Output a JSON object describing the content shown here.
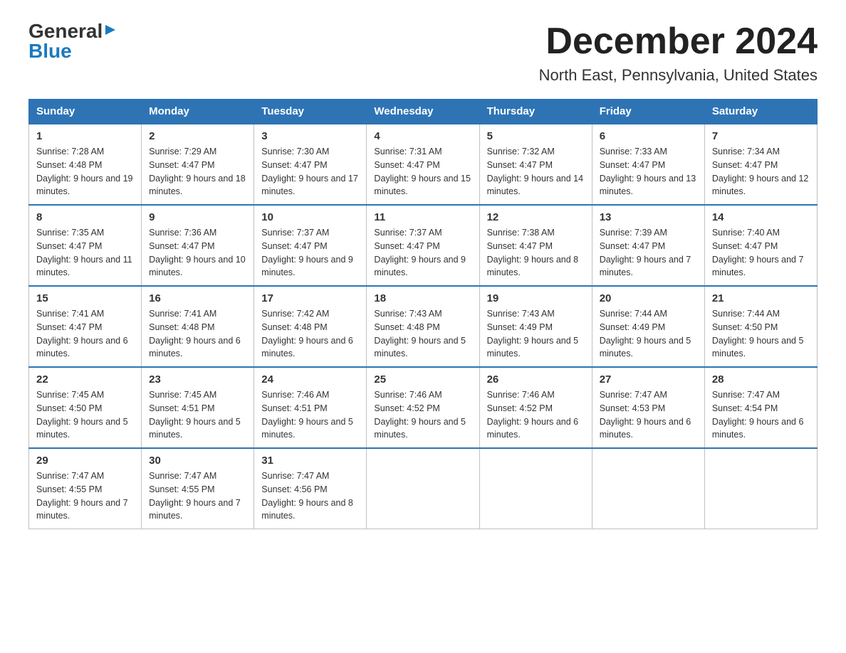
{
  "header": {
    "logo_general": "General",
    "logo_blue": "Blue",
    "month_title": "December 2024",
    "location": "North East, Pennsylvania, United States"
  },
  "days_of_week": [
    "Sunday",
    "Monday",
    "Tuesday",
    "Wednesday",
    "Thursday",
    "Friday",
    "Saturday"
  ],
  "weeks": [
    [
      {
        "day": "1",
        "sunrise": "7:28 AM",
        "sunset": "4:48 PM",
        "daylight": "9 hours and 19 minutes."
      },
      {
        "day": "2",
        "sunrise": "7:29 AM",
        "sunset": "4:47 PM",
        "daylight": "9 hours and 18 minutes."
      },
      {
        "day": "3",
        "sunrise": "7:30 AM",
        "sunset": "4:47 PM",
        "daylight": "9 hours and 17 minutes."
      },
      {
        "day": "4",
        "sunrise": "7:31 AM",
        "sunset": "4:47 PM",
        "daylight": "9 hours and 15 minutes."
      },
      {
        "day": "5",
        "sunrise": "7:32 AM",
        "sunset": "4:47 PM",
        "daylight": "9 hours and 14 minutes."
      },
      {
        "day": "6",
        "sunrise": "7:33 AM",
        "sunset": "4:47 PM",
        "daylight": "9 hours and 13 minutes."
      },
      {
        "day": "7",
        "sunrise": "7:34 AM",
        "sunset": "4:47 PM",
        "daylight": "9 hours and 12 minutes."
      }
    ],
    [
      {
        "day": "8",
        "sunrise": "7:35 AM",
        "sunset": "4:47 PM",
        "daylight": "9 hours and 11 minutes."
      },
      {
        "day": "9",
        "sunrise": "7:36 AM",
        "sunset": "4:47 PM",
        "daylight": "9 hours and 10 minutes."
      },
      {
        "day": "10",
        "sunrise": "7:37 AM",
        "sunset": "4:47 PM",
        "daylight": "9 hours and 9 minutes."
      },
      {
        "day": "11",
        "sunrise": "7:37 AM",
        "sunset": "4:47 PM",
        "daylight": "9 hours and 9 minutes."
      },
      {
        "day": "12",
        "sunrise": "7:38 AM",
        "sunset": "4:47 PM",
        "daylight": "9 hours and 8 minutes."
      },
      {
        "day": "13",
        "sunrise": "7:39 AM",
        "sunset": "4:47 PM",
        "daylight": "9 hours and 7 minutes."
      },
      {
        "day": "14",
        "sunrise": "7:40 AM",
        "sunset": "4:47 PM",
        "daylight": "9 hours and 7 minutes."
      }
    ],
    [
      {
        "day": "15",
        "sunrise": "7:41 AM",
        "sunset": "4:47 PM",
        "daylight": "9 hours and 6 minutes."
      },
      {
        "day": "16",
        "sunrise": "7:41 AM",
        "sunset": "4:48 PM",
        "daylight": "9 hours and 6 minutes."
      },
      {
        "day": "17",
        "sunrise": "7:42 AM",
        "sunset": "4:48 PM",
        "daylight": "9 hours and 6 minutes."
      },
      {
        "day": "18",
        "sunrise": "7:43 AM",
        "sunset": "4:48 PM",
        "daylight": "9 hours and 5 minutes."
      },
      {
        "day": "19",
        "sunrise": "7:43 AM",
        "sunset": "4:49 PM",
        "daylight": "9 hours and 5 minutes."
      },
      {
        "day": "20",
        "sunrise": "7:44 AM",
        "sunset": "4:49 PM",
        "daylight": "9 hours and 5 minutes."
      },
      {
        "day": "21",
        "sunrise": "7:44 AM",
        "sunset": "4:50 PM",
        "daylight": "9 hours and 5 minutes."
      }
    ],
    [
      {
        "day": "22",
        "sunrise": "7:45 AM",
        "sunset": "4:50 PM",
        "daylight": "9 hours and 5 minutes."
      },
      {
        "day": "23",
        "sunrise": "7:45 AM",
        "sunset": "4:51 PM",
        "daylight": "9 hours and 5 minutes."
      },
      {
        "day": "24",
        "sunrise": "7:46 AM",
        "sunset": "4:51 PM",
        "daylight": "9 hours and 5 minutes."
      },
      {
        "day": "25",
        "sunrise": "7:46 AM",
        "sunset": "4:52 PM",
        "daylight": "9 hours and 5 minutes."
      },
      {
        "day": "26",
        "sunrise": "7:46 AM",
        "sunset": "4:52 PM",
        "daylight": "9 hours and 6 minutes."
      },
      {
        "day": "27",
        "sunrise": "7:47 AM",
        "sunset": "4:53 PM",
        "daylight": "9 hours and 6 minutes."
      },
      {
        "day": "28",
        "sunrise": "7:47 AM",
        "sunset": "4:54 PM",
        "daylight": "9 hours and 6 minutes."
      }
    ],
    [
      {
        "day": "29",
        "sunrise": "7:47 AM",
        "sunset": "4:55 PM",
        "daylight": "9 hours and 7 minutes."
      },
      {
        "day": "30",
        "sunrise": "7:47 AM",
        "sunset": "4:55 PM",
        "daylight": "9 hours and 7 minutes."
      },
      {
        "day": "31",
        "sunrise": "7:47 AM",
        "sunset": "4:56 PM",
        "daylight": "9 hours and 8 minutes."
      },
      null,
      null,
      null,
      null
    ]
  ]
}
